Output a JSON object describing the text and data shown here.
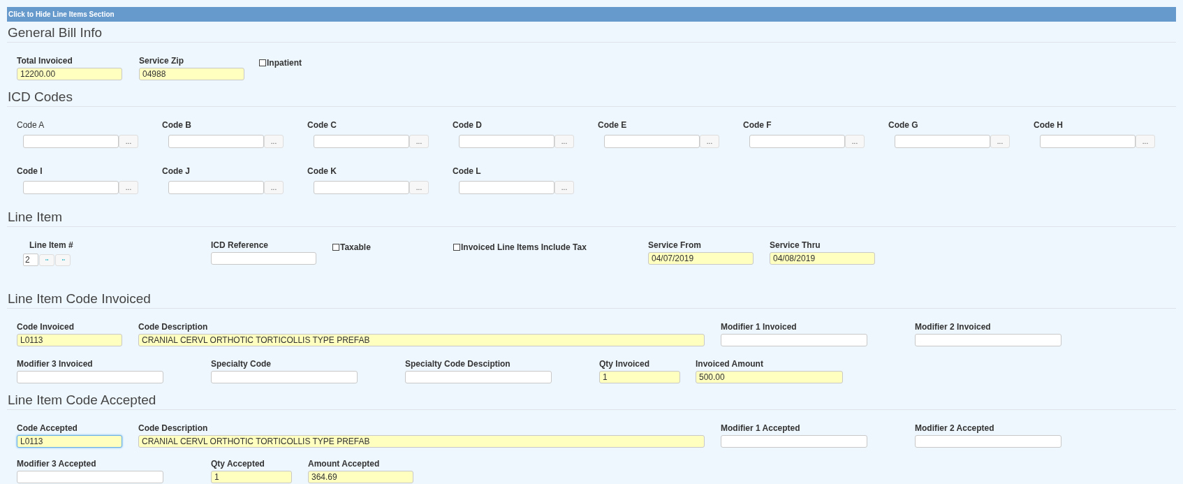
{
  "header_link": "Click to Hide Line Items Section",
  "sections": [
    {
      "title": "General Bill Info",
      "rows": [
        {
          "fields": [
            {
              "kind": "text",
              "label": "Total Invoiced",
              "value": "12200.00",
              "highlighted": true,
              "focused": false
            },
            {
              "kind": "text",
              "label": "Service Zip",
              "value": "04988",
              "highlighted": true,
              "focused": false
            },
            {
              "kind": "checkbox",
              "label": "Inpatient",
              "checked": false
            }
          ]
        }
      ]
    },
    {
      "title": "ICD Codes",
      "rows": [
        {
          "fields": [
            {
              "kind": "lookup",
              "label": "Code A",
              "bold": false,
              "button": "..."
            },
            {
              "kind": "lookup",
              "label": "Code B",
              "bold": true,
              "button": "..."
            },
            {
              "kind": "lookup",
              "label": "Code C",
              "bold": true,
              "button": "..."
            },
            {
              "kind": "lookup",
              "label": "Code D",
              "bold": true,
              "button": "..."
            },
            {
              "kind": "lookup",
              "label": "Code E",
              "bold": true,
              "button": "..."
            },
            {
              "kind": "lookup",
              "label": "Code F",
              "bold": true,
              "button": "..."
            },
            {
              "kind": "lookup",
              "label": "Code G",
              "bold": true,
              "button": "..."
            },
            {
              "kind": "lookup",
              "label": "Code H",
              "bold": true,
              "button": "..."
            }
          ]
        },
        {
          "fields": [
            {
              "kind": "lookup",
              "label": "Code I",
              "bold": true,
              "button": "..."
            },
            {
              "kind": "lookup",
              "label": "Code J",
              "bold": true,
              "button": "..."
            },
            {
              "kind": "lookup",
              "label": "Code K",
              "bold": true,
              "button": "..."
            },
            {
              "kind": "lookup",
              "label": "Code L",
              "bold": true,
              "button": "..."
            }
          ]
        }
      ]
    },
    {
      "title": "Line Item",
      "rows": [
        {
          "fields": [
            {
              "kind": "stepper",
              "label": "Line Item #",
              "value": "2"
            },
            {
              "kind": "text",
              "label": "ICD Reference",
              "highlighted": false,
              "focused": false
            },
            {
              "kind": "checkbox",
              "label": "Taxable",
              "checked": false
            },
            {
              "kind": "checkbox",
              "label": "Invoiced Line Items Include Tax",
              "checked": false
            },
            {
              "kind": "text",
              "label": "Service From",
              "value": "04/07/2019",
              "highlighted": true,
              "focused": false
            },
            {
              "kind": "text",
              "label": "Service Thru",
              "value": "04/08/2019",
              "highlighted": true,
              "focused": false
            }
          ]
        }
      ]
    },
    {
      "title": "Line Item Code Invoiced",
      "rows": [
        {
          "fields": [
            {
              "kind": "text",
              "label": "Code Invoiced",
              "value": "L0113",
              "highlighted": true,
              "focused": false
            },
            {
              "kind": "text",
              "label": "Code Description",
              "value": "CRANIAL CERVL ORTHOTIC TORTICOLLIS TYPE PREFAB",
              "highlighted": true,
              "focused": false
            },
            {
              "kind": "text",
              "label": "Modifier 1 Invoiced",
              "highlighted": false,
              "focused": false
            },
            {
              "kind": "text",
              "label": "Modifier 2 Invoiced",
              "highlighted": false,
              "focused": false
            }
          ]
        },
        {
          "fields": [
            {
              "kind": "text",
              "label": "Modifier 3 Invoiced",
              "highlighted": false,
              "focused": false
            },
            {
              "kind": "text",
              "label": "Specialty Code",
              "highlighted": false,
              "focused": false
            },
            {
              "kind": "text",
              "label": "Specialty Code Desciption",
              "highlighted": false,
              "focused": false
            },
            {
              "kind": "text",
              "label": "Qty Invoiced",
              "value": "1",
              "highlighted": true,
              "focused": false
            },
            {
              "kind": "text",
              "label": "Invoiced Amount",
              "value": "500.00",
              "highlighted": true,
              "focused": false
            }
          ]
        }
      ]
    },
    {
      "title": "Line Item Code Accepted",
      "rows": [
        {
          "fields": [
            {
              "kind": "text",
              "label": "Code Accepted",
              "value": "L0113",
              "highlighted": true,
              "focused": true
            },
            {
              "kind": "text",
              "label": "Code Description",
              "value": "CRANIAL CERVL ORTHOTIC TORTICOLLIS TYPE PREFAB",
              "highlighted": true,
              "focused": false
            },
            {
              "kind": "text",
              "label": "Modifier 1 Accepted",
              "highlighted": false,
              "focused": false
            },
            {
              "kind": "text",
              "label": "Modifier 2 Accepted",
              "highlighted": false,
              "focused": false
            }
          ]
        },
        {
          "fields": [
            {
              "kind": "text",
              "label": "Modifier 3 Accepted",
              "highlighted": false,
              "focused": false
            },
            {
              "kind": "text",
              "label": "Qty Accepted",
              "value": "1",
              "highlighted": true,
              "focused": false
            },
            {
              "kind": "text",
              "label": "Amount Accepted",
              "value": "364.69",
              "highlighted": true,
              "focused": false
            }
          ]
        }
      ]
    }
  ]
}
